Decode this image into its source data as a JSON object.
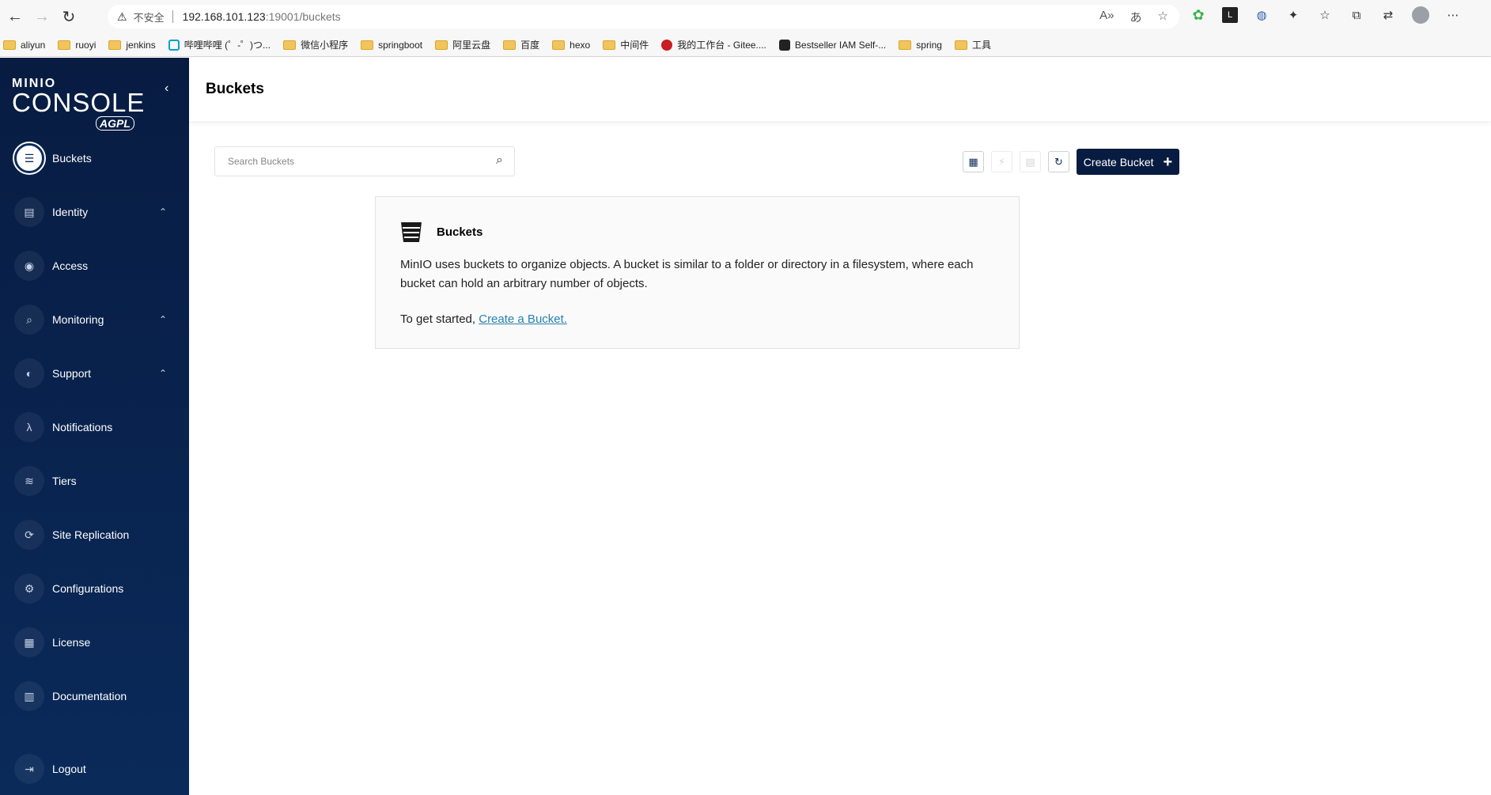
{
  "browser": {
    "insecure_label": "不安全",
    "url_host": "192.168.101.123",
    "url_path": ":19001/buckets",
    "bookmarks": [
      "aliyun",
      "ruoyi",
      "jenkins",
      "哔哩哔哩 (゜-゜)つ...",
      "微信小程序",
      "springboot",
      "阿里云盘",
      "百度",
      "hexo",
      "中间件",
      "我的工作台 - Gitee....",
      "Bestseller IAM Self-...",
      "spring",
      "工具"
    ]
  },
  "sidebar": {
    "logo_top": "MINIO",
    "logo_main": "CONSOLE",
    "logo_badge": "AGPL",
    "items": [
      {
        "label": "Buckets",
        "icon": "bucket-icon",
        "glyph": "☰",
        "expandable": false
      },
      {
        "label": "Identity",
        "icon": "identity-icon",
        "glyph": "▤",
        "expandable": true
      },
      {
        "label": "Access",
        "icon": "access-icon",
        "glyph": "◉",
        "expandable": false
      },
      {
        "label": "Monitoring",
        "icon": "monitoring-icon",
        "glyph": "⌕",
        "expandable": true
      },
      {
        "label": "Support",
        "icon": "support-icon",
        "glyph": "◐",
        "expandable": true
      },
      {
        "label": "Notifications",
        "icon": "lambda-icon",
        "glyph": "λ",
        "expandable": false
      },
      {
        "label": "Tiers",
        "icon": "tiers-icon",
        "glyph": "≋",
        "expandable": false
      },
      {
        "label": "Site Replication",
        "icon": "site-replication-icon",
        "glyph": "⟳",
        "expandable": false
      },
      {
        "label": "Configurations",
        "icon": "gear-icon",
        "glyph": "⚙",
        "expandable": false
      },
      {
        "label": "License",
        "icon": "license-icon",
        "glyph": "▦",
        "expandable": false
      },
      {
        "label": "Documentation",
        "icon": "documentation-icon",
        "glyph": "▥",
        "expandable": false
      },
      {
        "label": "Logout",
        "icon": "logout-icon",
        "glyph": "⇥",
        "expandable": false
      }
    ]
  },
  "header": {
    "title": "Buckets"
  },
  "search": {
    "placeholder": "Search Buckets",
    "value": ""
  },
  "toolbar": {
    "create_label": "Create Bucket"
  },
  "card": {
    "title": "Buckets",
    "description": "MinIO uses buckets to organize objects. A bucket is similar to a folder or directory in a filesystem, where each bucket can hold an arbitrary number of objects.",
    "cta_prefix": "To get started,",
    "cta_link": "Create a Bucket."
  },
  "colors": {
    "sidebar": "#081c42",
    "accent": "#2781b0",
    "button": "#081c42"
  }
}
